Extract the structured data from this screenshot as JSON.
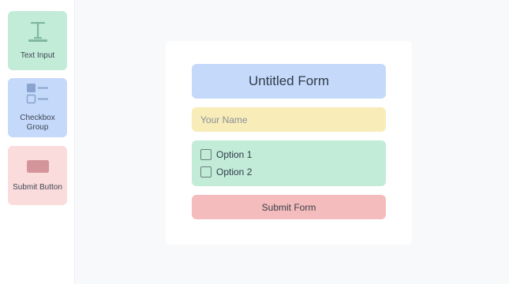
{
  "palette": {
    "title": "Text Input",
    "items": [
      {
        "label": "Text Input",
        "icon": "text-icon"
      },
      {
        "label": "Checkbox Group",
        "icon": "checkbox-list-icon"
      },
      {
        "label": "Submit Button",
        "icon": "button-icon"
      }
    ]
  },
  "form": {
    "title": "Untitled Form",
    "name_placeholder": "Your Name",
    "name_value": "",
    "options": [
      {
        "label": "Option 1",
        "checked": false
      },
      {
        "label": "Option 2",
        "checked": false
      }
    ],
    "submit_label": "Submit Form"
  },
  "colors": {
    "text_input": "#c2ecd8",
    "checkbox_group": "#c5dafa",
    "submit_button": "#fadcdc",
    "title_block": "#c5dafa",
    "name_field": "#f8ecb8",
    "submit_form": "#f4bcbc"
  }
}
